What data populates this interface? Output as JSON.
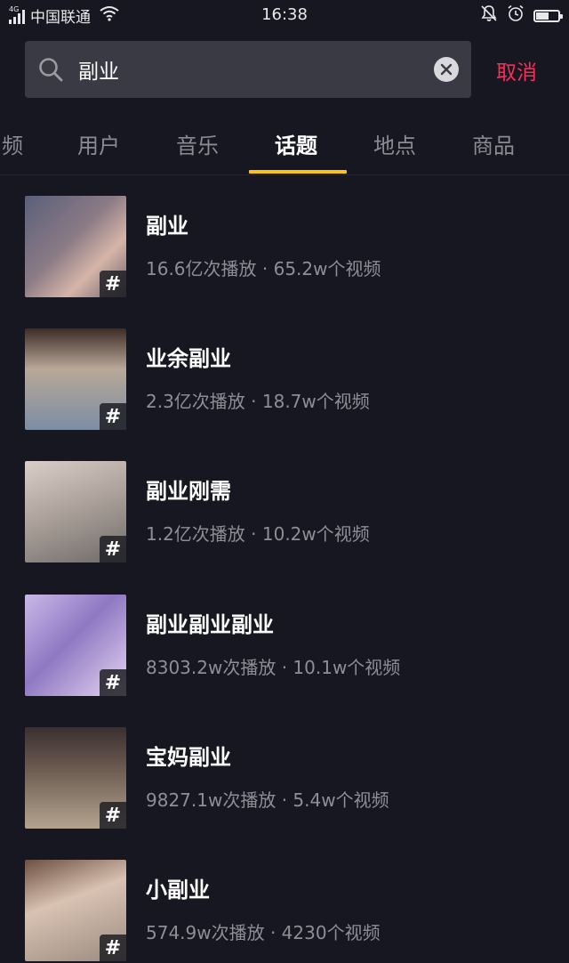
{
  "status_bar": {
    "network_type": "4G",
    "carrier": "中国联通",
    "time": "16:38",
    "battery_level": 0.6,
    "icons": [
      "signal-icon",
      "wifi-icon",
      "mute-icon",
      "alarm-icon",
      "battery-icon"
    ]
  },
  "search": {
    "query": "副业",
    "cancel_label": "取消"
  },
  "tabs": [
    {
      "label": "频",
      "active": false
    },
    {
      "label": "用户",
      "active": false
    },
    {
      "label": "音乐",
      "active": false
    },
    {
      "label": "话题",
      "active": true
    },
    {
      "label": "地点",
      "active": false
    },
    {
      "label": "商品",
      "active": false
    }
  ],
  "topics": [
    {
      "title": "副业",
      "stats": "16.6亿次播放 · 65.2w个视频",
      "badge": "#"
    },
    {
      "title": "业余副业",
      "stats": "2.3亿次播放 · 18.7w个视频",
      "badge": "#"
    },
    {
      "title": "副业刚需",
      "stats": "1.2亿次播放 · 10.2w个视频",
      "badge": "#"
    },
    {
      "title": "副业副业副业",
      "stats": "8303.2w次播放 · 10.1w个视频",
      "badge": "#"
    },
    {
      "title": "宝妈副业",
      "stats": "9827.1w次播放 · 5.4w个视频",
      "badge": "#"
    },
    {
      "title": "小副业",
      "stats": "574.9w次播放 · 4230个视频",
      "badge": "#"
    }
  ],
  "colors": {
    "background": "#171722",
    "accent_cancel": "#fe2c55",
    "tab_indicator": "#f9c416",
    "search_bg": "#3a3a44"
  }
}
